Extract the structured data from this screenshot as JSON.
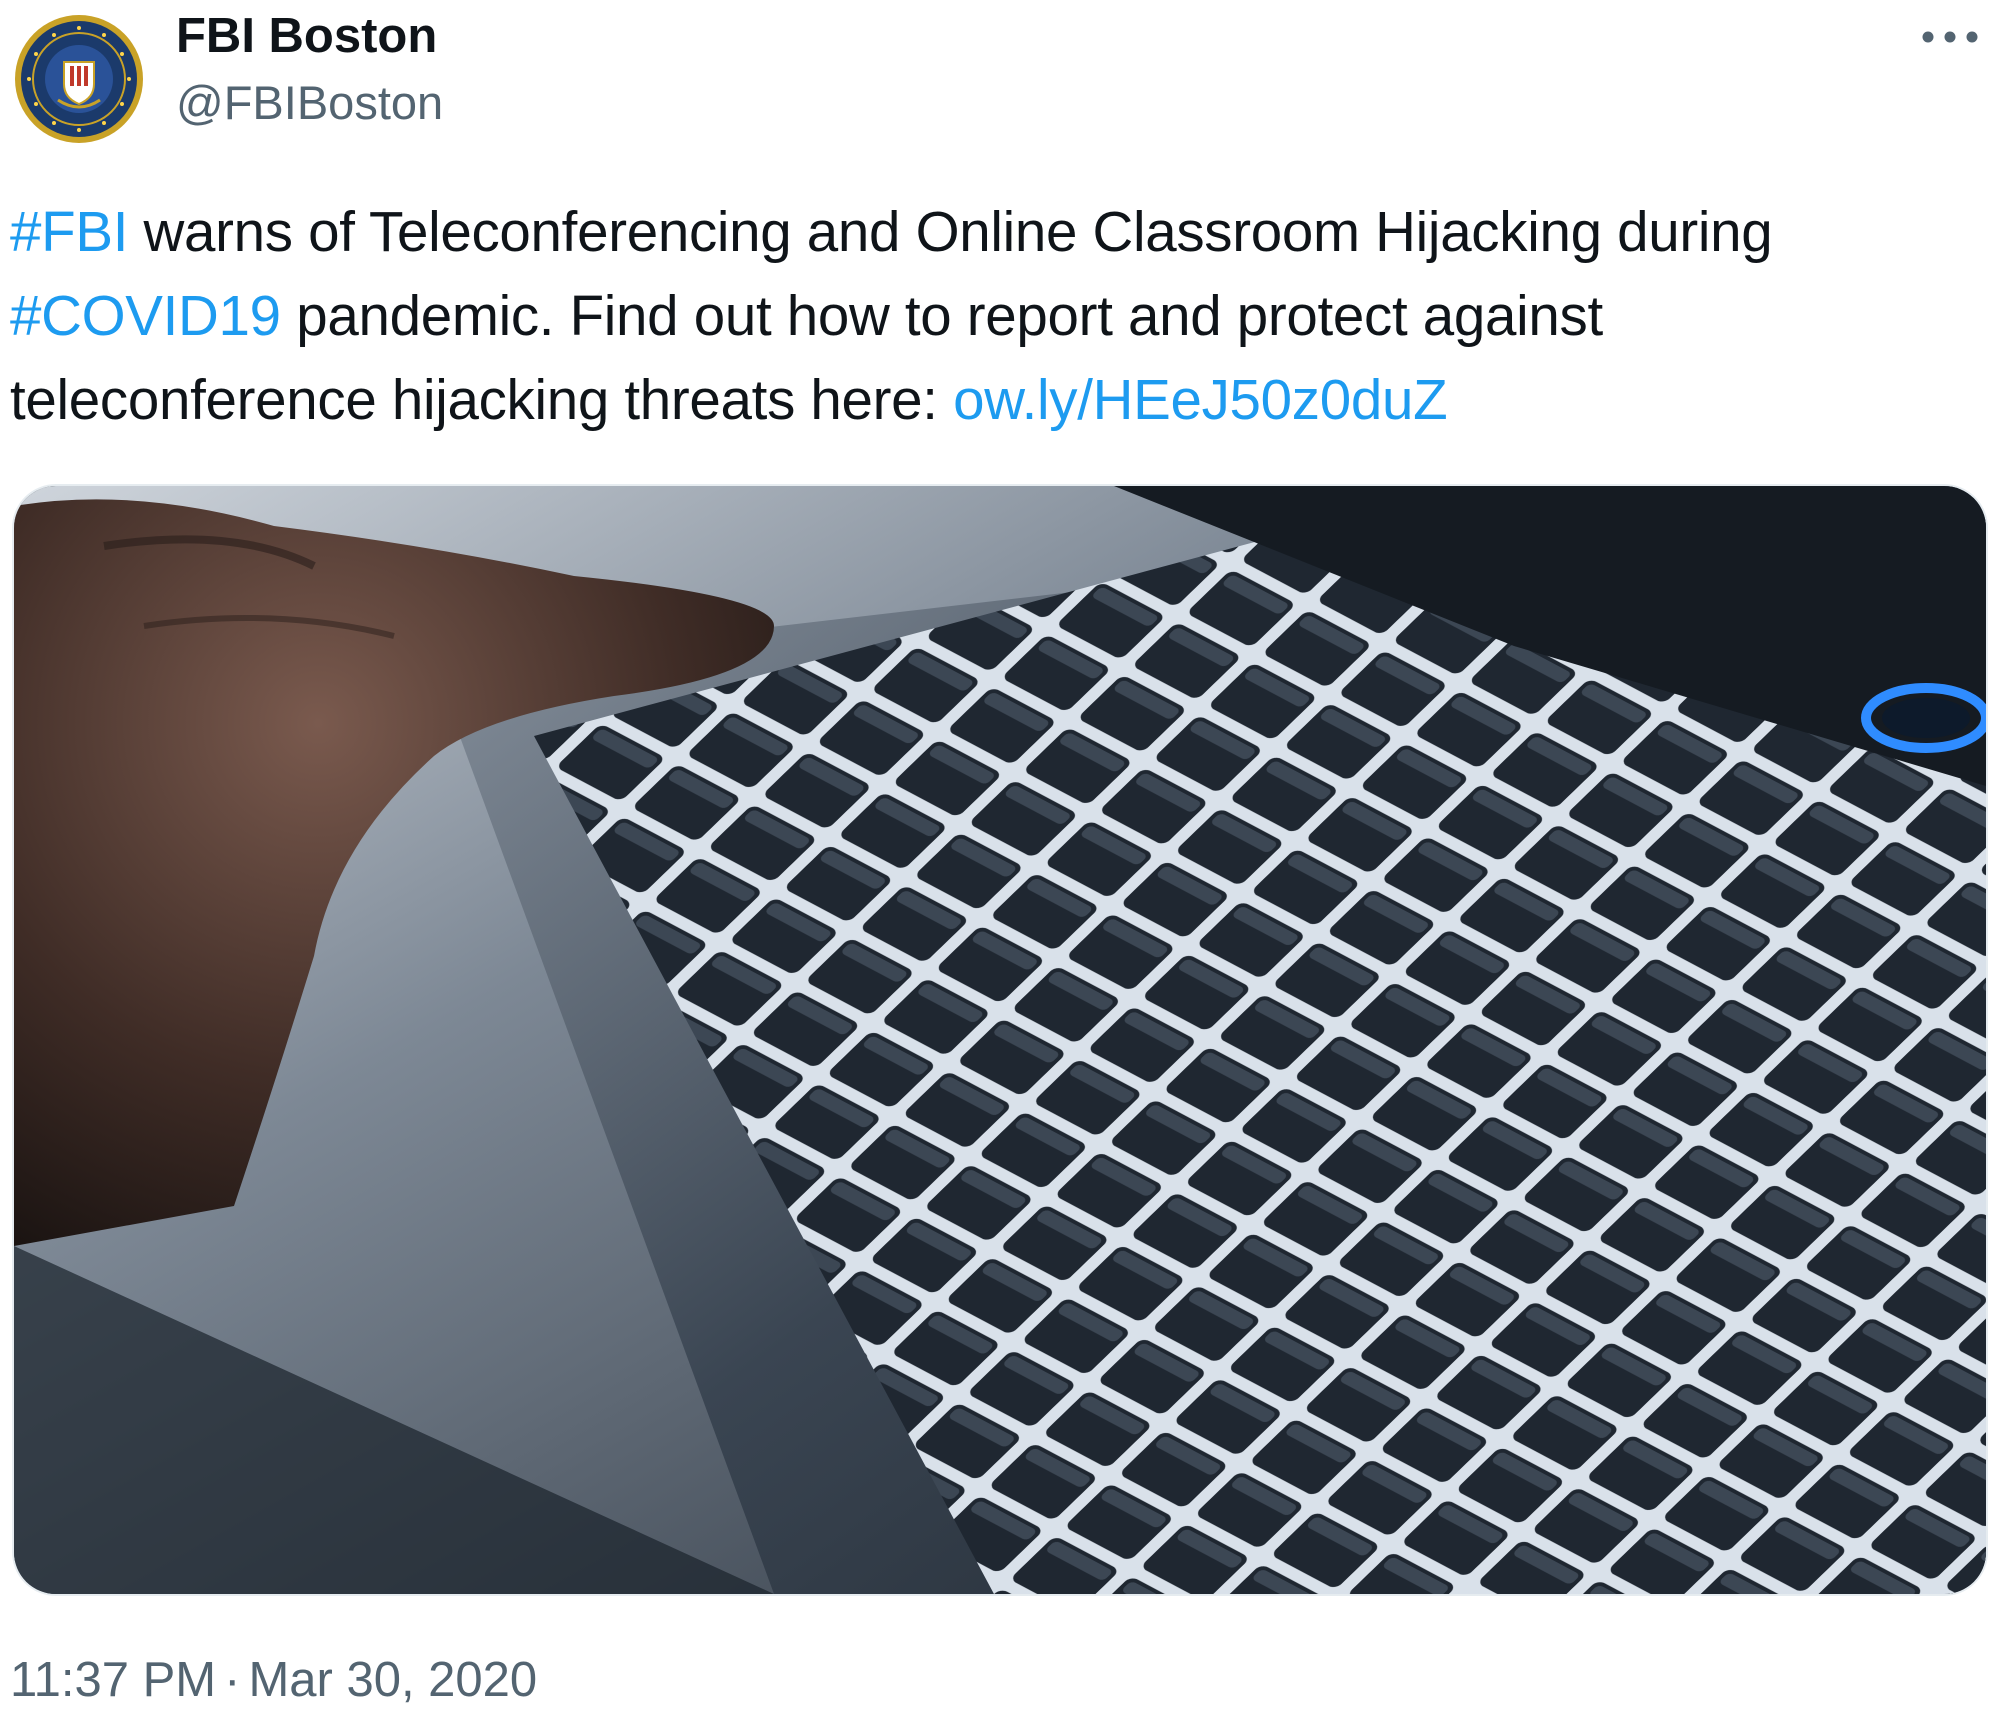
{
  "author": {
    "display_name": "FBI Boston",
    "handle": "@FBIBoston",
    "avatar_icon": "fbi-seal-icon"
  },
  "more_icon": "more-options-icon",
  "tweet": {
    "line1_hashtag": "#FBI",
    "line1_text": " warns of Teleconferencing and Online Classroom Hijacking during",
    "line2_hashtag": "#COVID19",
    "line2_text": " pandemic. Find out how to report and protect against",
    "line3_text": "teleconference hijacking threats here: ",
    "line3_link": "ow.ly/HEeJ50z0duZ"
  },
  "media": {
    "description_icon": "keyboard-hand-photo"
  },
  "meta": {
    "time": "11:37 PM",
    "separator": "·",
    "date": "Mar 30, 2020"
  },
  "colors": {
    "link": "#1d9bf0",
    "secondary": "#536471",
    "primary_text": "#0f1419",
    "seal_blue": "#1b3a6b",
    "seal_gold": "#c9a227"
  }
}
